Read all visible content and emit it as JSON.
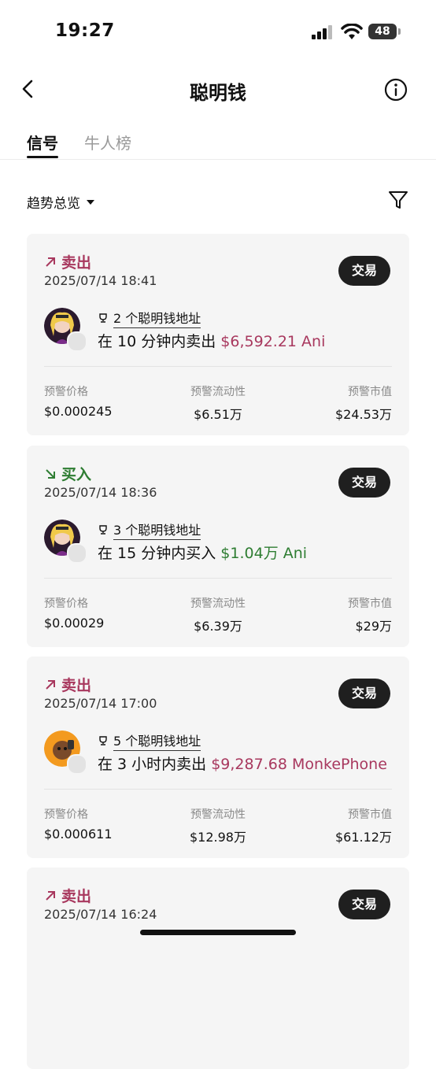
{
  "status": {
    "time": "19:27",
    "battery": "48"
  },
  "nav": {
    "title": "聪明钱"
  },
  "tabs": [
    {
      "label": "信号"
    },
    {
      "label": "牛人榜"
    }
  ],
  "filter": {
    "label": "趋势总览"
  },
  "colors": {
    "sell": "#a8385e",
    "buy": "#2e7d32",
    "button": "#1f1f1f"
  },
  "cards": [
    {
      "side": "卖出",
      "time": "2025/07/14 18:41",
      "trade_label": "交易",
      "address_count_label": "2 个聪明钱地址",
      "desc_prefix": "在 10 分钟内卖出 ",
      "desc_amount": "$6,592.21 Ani",
      "metrics": [
        {
          "label": "预警价格",
          "value": "$0.000245"
        },
        {
          "label": "预警流动性",
          "value": "$6.51万"
        },
        {
          "label": "预警市值",
          "value": "$24.53万"
        }
      ],
      "token_icon": "ani-avatar"
    },
    {
      "side": "买入",
      "time": "2025/07/14 18:36",
      "trade_label": "交易",
      "address_count_label": "3 个聪明钱地址",
      "desc_prefix": "在 15 分钟内买入 ",
      "desc_amount": "$1.04万 Ani",
      "metrics": [
        {
          "label": "预警价格",
          "value": "$0.00029"
        },
        {
          "label": "预警流动性",
          "value": "$6.39万"
        },
        {
          "label": "预警市值",
          "value": "$29万"
        }
      ],
      "token_icon": "ani-avatar"
    },
    {
      "side": "卖出",
      "time": "2025/07/14 17:00",
      "trade_label": "交易",
      "address_count_label": "5 个聪明钱地址",
      "desc_prefix": "在 3 小时内卖出 ",
      "desc_amount": "$9,287.68 MonkePhone",
      "metrics": [
        {
          "label": "预警价格",
          "value": "$0.000611"
        },
        {
          "label": "预警流动性",
          "value": "$12.98万"
        },
        {
          "label": "预警市值",
          "value": "$61.12万"
        }
      ],
      "token_icon": "monkephone-avatar"
    },
    {
      "side": "卖出",
      "time": "2025/07/14 16:24",
      "trade_label": "交易"
    }
  ]
}
